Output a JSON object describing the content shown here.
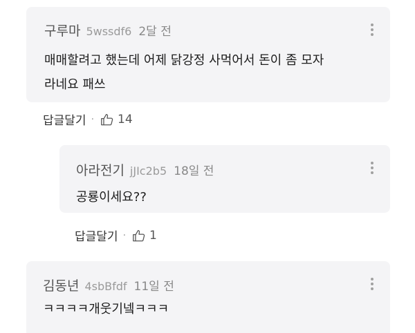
{
  "comments": [
    {
      "author": "구루마",
      "uid": "5wssdf6",
      "time": "2달 전",
      "lines": [
        "매매할려고 했는데 어제 닭강정 사먹어서 돈이 좀 모자",
        "라네요 패쓰"
      ]
    },
    {
      "author": "아라전기",
      "uid": "jJIc2b5",
      "time": "18일 전",
      "lines": [
        "공룡이세요??"
      ]
    },
    {
      "author": "김동년",
      "uid": "4sbBfdf",
      "time": "11일 전",
      "lines": [
        "ㅋㅋㅋㅋ개웃기넼ㅋㅋㅋ"
      ]
    }
  ],
  "actions": [
    {
      "reply_label": "답글달기",
      "separator": "·",
      "likes": "14"
    },
    {
      "reply_label": "답글달기",
      "separator": "·",
      "likes": "1"
    }
  ],
  "icons": {
    "like": "thumbs-up-icon",
    "more": "more-vertical-icon"
  },
  "colors": {
    "card_bg": "#f4f4f6",
    "meta": "#9a9a9a"
  }
}
